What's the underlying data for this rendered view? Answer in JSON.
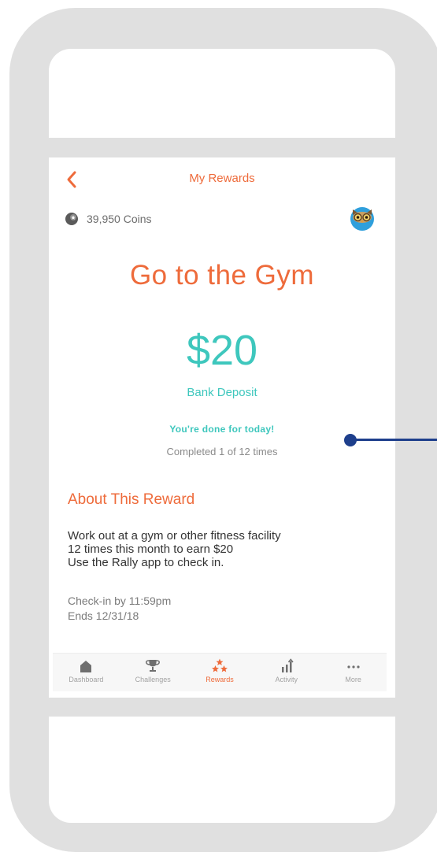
{
  "header": {
    "title": "My Rewards"
  },
  "coins": {
    "text": "39,950 Coins"
  },
  "reward": {
    "title": "Go to the Gym",
    "amount": "$20",
    "type": "Bank Deposit",
    "status": "You're done for today!",
    "progress_text": "Completed 1 of 12 times",
    "progress": {
      "completed": 1,
      "total": 12
    }
  },
  "about": {
    "heading": "About This Reward",
    "lines": [
      "Work out at a gym or other fitness facility",
      "12 times this month to earn $20",
      "Use the Rally app to check in."
    ],
    "checkin": "Check-in by 11:59pm",
    "ends": "Ends 12/31/18"
  },
  "tabs": [
    {
      "label": "Dashboard",
      "icon": "home-icon",
      "active": false
    },
    {
      "label": "Challenges",
      "icon": "trophy-icon",
      "active": false
    },
    {
      "label": "Rewards",
      "icon": "stars-icon",
      "active": true
    },
    {
      "label": "Activity",
      "icon": "bar-chart-icon",
      "active": false
    },
    {
      "label": "More",
      "icon": "more-dots-icon",
      "active": false
    }
  ],
  "colors": {
    "accent": "#ee6b3b",
    "teal": "#3ec7bd",
    "callout": "#1e3f8c",
    "bezel": "#e0e0e0"
  }
}
